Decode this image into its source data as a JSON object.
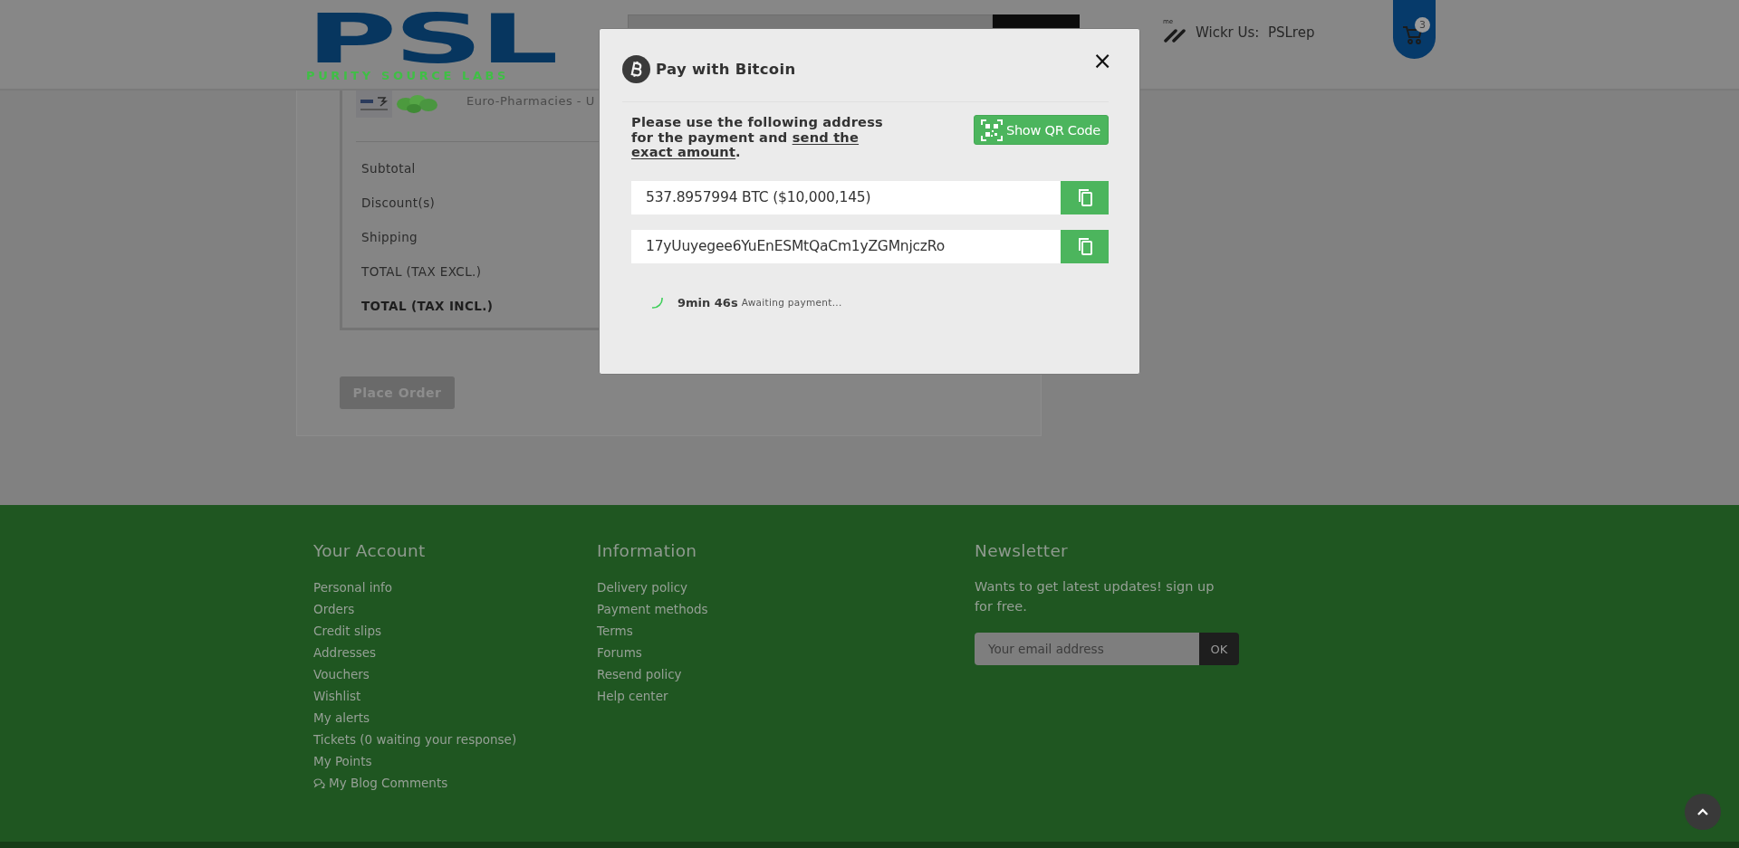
{
  "header": {
    "logo": {
      "title": "PSL",
      "subtitle": "PURITY SOURCE LABS"
    },
    "wickr": {
      "icon_label": "me",
      "label": "Wickr Us:",
      "value": "PSLrep"
    },
    "cart": {
      "count": "3"
    }
  },
  "order": {
    "product": {
      "name": "Euro-Pharmacies - U"
    },
    "summary": [
      {
        "label": "Subtotal",
        "bold": false
      },
      {
        "label": "Discount(s)",
        "bold": false
      },
      {
        "label": "Shipping",
        "bold": false
      },
      {
        "label": "TOTAL (TAX EXCL.)",
        "bold": false
      },
      {
        "label": "TOTAL (TAX INCL.)",
        "bold": true
      }
    ],
    "place_order": {
      "label": "Place Order",
      "disabled": true
    }
  },
  "modal": {
    "title": "Pay with Bitcoin",
    "close": "×",
    "instruction": {
      "text": "Please use the following address for the payment and",
      "emphasis": "send the exact amount",
      "after": "."
    },
    "qr_button": "Show QR Code",
    "fields": [
      {
        "value": "537.8957994 BTC ($10,000,145)"
      },
      {
        "value": "17yUuyegee6YuEnESMtQaCm1yZGMnjczRo"
      }
    ],
    "status": {
      "timer": "9min 46s",
      "message": "Awaiting payment..."
    }
  },
  "footer": {
    "columns": [
      {
        "title": "Your Account",
        "links": [
          {
            "label": "Personal info",
            "kind": "plain"
          },
          {
            "label": "Orders",
            "kind": "plain"
          },
          {
            "label": "Credit slips",
            "kind": "plain"
          },
          {
            "label": "Addresses",
            "kind": "plain"
          },
          {
            "label": "Vouchers",
            "kind": "plain"
          },
          {
            "label": "Wishlist",
            "kind": "plain"
          },
          {
            "label": "My alerts",
            "kind": "plain"
          },
          {
            "label": "Tickets (0 waiting your response)",
            "kind": "plain"
          },
          {
            "label": "My Points",
            "kind": "plain"
          },
          {
            "label": "My Blog Comments",
            "kind": "comments"
          }
        ]
      },
      {
        "title": "Information",
        "links": [
          {
            "label": "Delivery policy",
            "kind": "plain"
          },
          {
            "label": "Payment methods",
            "kind": "plain"
          },
          {
            "label": "Terms",
            "kind": "plain"
          },
          {
            "label": "Forums",
            "kind": "plain"
          },
          {
            "label": "Resend policy",
            "kind": "plain"
          },
          {
            "label": "Help center",
            "kind": "plain"
          }
        ]
      }
    ],
    "newsletter": {
      "title": "Newsletter",
      "text": "Wants to get latest updates! sign up for free.",
      "placeholder": "Your email address",
      "button": "OK"
    }
  }
}
